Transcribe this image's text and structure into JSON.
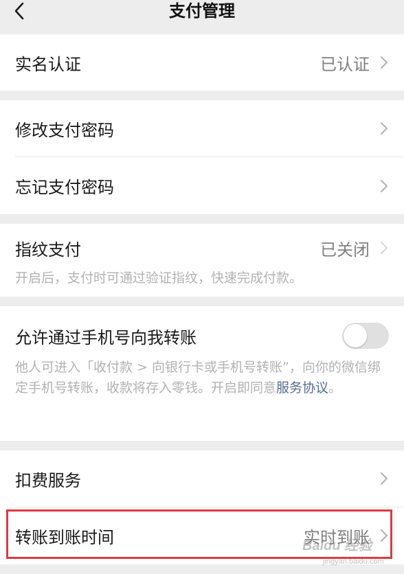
{
  "nav": {
    "title": "支付管理"
  },
  "section_realname": {
    "label": "实名认证",
    "value": "已认证"
  },
  "section_password": {
    "change_label": "修改支付密码",
    "forgot_label": "忘记支付密码"
  },
  "section_fingerprint": {
    "label": "指纹支付",
    "value": "已关闭",
    "description": "开启后，支付时可通过验证指纹，快速完成付款。"
  },
  "section_phone_transfer": {
    "label": "允许通过手机号向我转账",
    "toggle_on": false,
    "description": "他人可进入「收付款 > 向银行卡或手机号转账”，向你的微信绑定手机号转账，收款将存入零钱。开启即同意",
    "link_text": "服务协议",
    "description_end": "。"
  },
  "section_services": {
    "deduction_label": "扣费服务",
    "transfer_time_label": "转账到账时间",
    "transfer_time_value": "实时到账"
  },
  "watermark": {
    "text": "Baidu 经验",
    "sub": "jingyan.baidu.com"
  },
  "colors": {
    "highlight_border": "#e0393e",
    "link": "#576b95"
  }
}
